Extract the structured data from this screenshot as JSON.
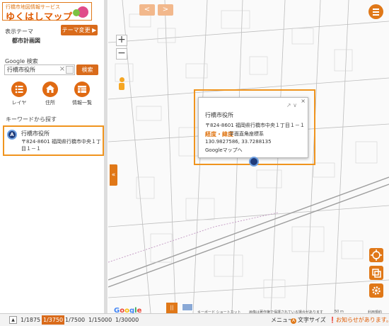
{
  "logo": {
    "subtitle": "行橋市地図情報サービス",
    "title": "ゆくはしマップ"
  },
  "theme": {
    "label": "表示テーマ",
    "name": "都市計画図",
    "change_button": "テーマ変更 ▶"
  },
  "google_search": {
    "label": "Google 検索",
    "value": "行橋市役所",
    "clear": "×",
    "button": "検索"
  },
  "tools": [
    {
      "label": "レイヤ",
      "icon": "list-icon"
    },
    {
      "label": "住所",
      "icon": "home-icon"
    },
    {
      "label": "情報一覧",
      "icon": "table-icon"
    }
  ],
  "keyword": {
    "label": "キーワードから探す",
    "result": {
      "marker": "A",
      "title": "行橋市役所",
      "address": "〒824-8601 福岡県行橋市中央１丁目１－１"
    }
  },
  "collapse": "«",
  "map": {
    "zoom_in": "+",
    "zoom_out": "−",
    "back": "<",
    "forward": ">",
    "legend_toggle": "||",
    "footer_shortcuts": "キーボード ショートカット",
    "footer_copyright": "画像は著作権で保護されている場合があります",
    "footer_scale": "50 m",
    "footer_terms": "利用規約"
  },
  "popup": {
    "close": "×",
    "share": "↗ ∨",
    "title": "行橋市役所",
    "address": "〒824-8601 福岡県行橋市中央１丁目１－１",
    "latlon_label": "経度・緯度",
    "coord_system": "平面直角座標系",
    "coords": "130.9827586, 33.7288135",
    "gmaps_link": "Googleマップへ"
  },
  "google_logo": [
    "G",
    "o",
    "o",
    "g",
    "l",
    "e"
  ],
  "bottom": {
    "toggle": "▲",
    "scales": [
      "1/1875",
      "1/3750",
      "1/7500",
      "1/15000",
      "1/30000"
    ],
    "active_scale": "1/3750",
    "menu": "メニュー",
    "font_size": "文字サイズ",
    "font_size_icon": "A",
    "notice": "❗お知らせがあります。"
  },
  "colors": {
    "accent": "#e07818",
    "button": "#d96b1b",
    "marker": "#1f3b7a"
  }
}
